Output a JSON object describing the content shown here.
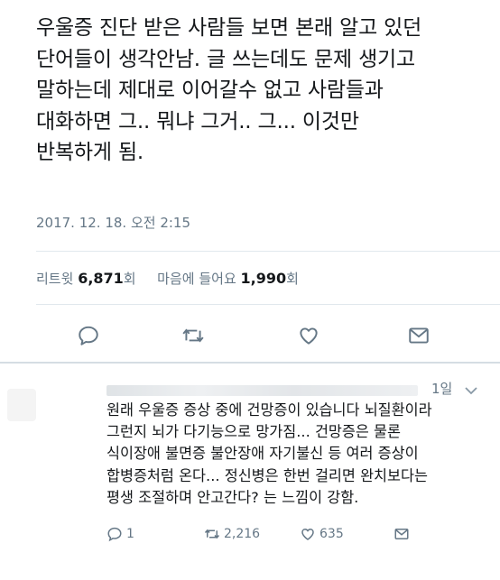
{
  "tweet": {
    "lines": [
      "우울증 진단 받은 사람들 보면 본래 알고 있던",
      "단어들이 생각안남. 글 쓰는데도 문제 생기고",
      "말하는데 제대로 이어갈수 없고 사람들과",
      "대화하면 그.. 뭐냐 그거.. 그... 이것만",
      "반복하게 됨."
    ],
    "timestamp": "2017. 12. 18. 오전 2:15",
    "retweet_label": "리트윗",
    "retweet_count": "6,871",
    "retweet_unit": "회",
    "like_label": "마음에 들어요",
    "like_count": "1,990",
    "like_unit": "회"
  },
  "icons": {
    "reply": "reply-icon",
    "retweet": "retweet-icon",
    "like": "heart-icon",
    "dm": "envelope-icon",
    "caret": "chevron-down-icon"
  },
  "reply": {
    "time": "1일",
    "lines": [
      "원래 우울증 증상 중에 건망증이 있습니다 뇌질환이라",
      "그런지 뇌가 다기능으로 망가짐... 건망증은 물론",
      "식이장애 불면증 불안장애 자기불신 등 여러 증상이",
      "합병증처럼 온다... 정신병은 한번 걸리면 완치보다는",
      "평생 조절하며 안고간다? 는 느낌이 강함."
    ],
    "reply_count": "1",
    "retweet_count": "2,216",
    "like_count": "635"
  },
  "colors": {
    "text": "#14171a",
    "muted": "#657786",
    "divider": "#e1e8ed"
  }
}
